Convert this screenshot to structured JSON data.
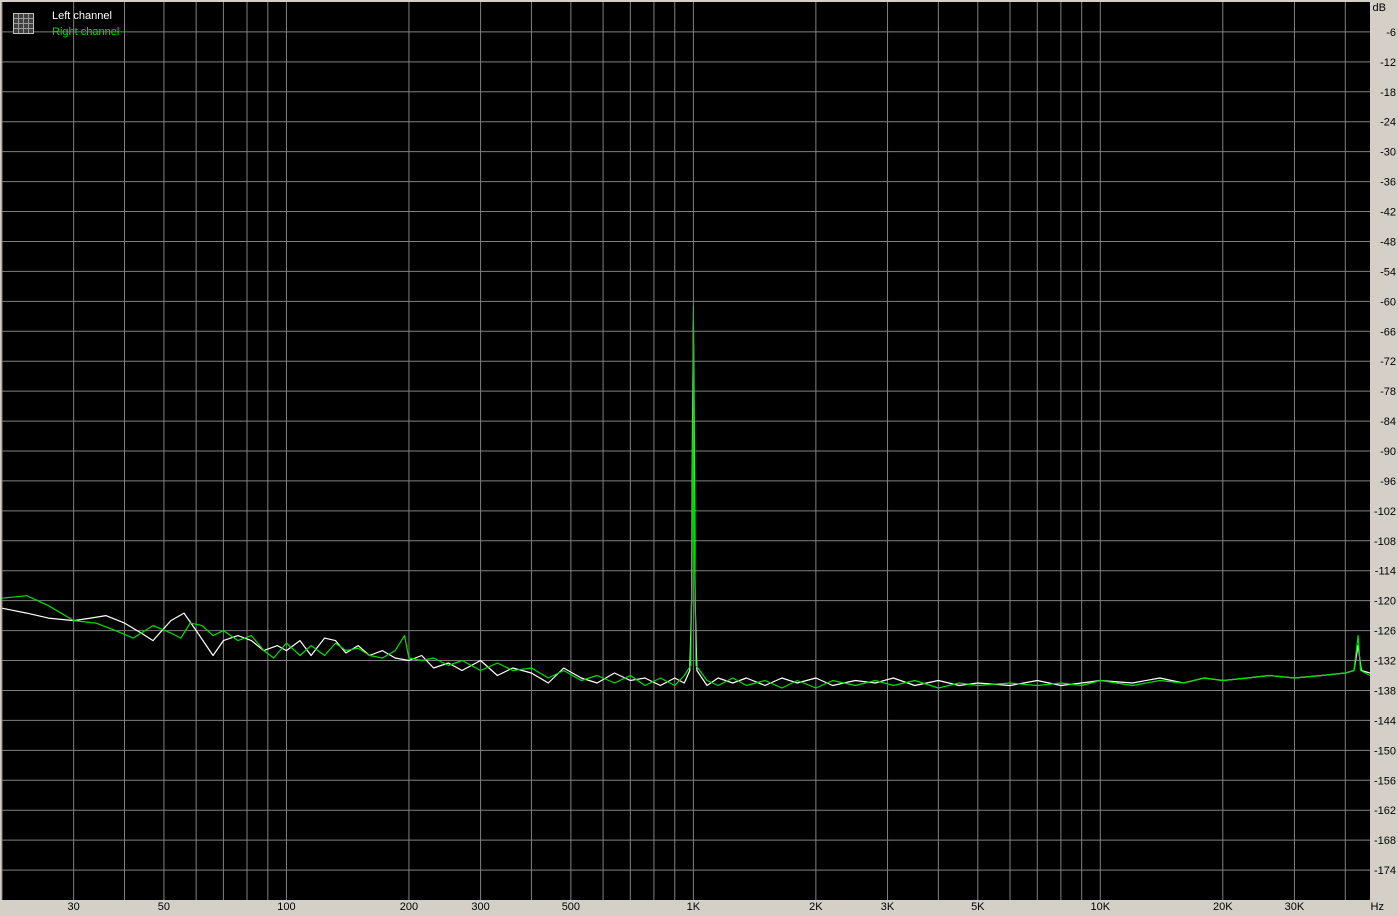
{
  "chart_data": {
    "type": "line",
    "title": "",
    "xlabel": "",
    "ylabel": "",
    "x_unit": "Hz",
    "y_unit": "dB",
    "x_scale": "log",
    "xlim": [
      20,
      46000
    ],
    "ylim": [
      -180,
      0
    ],
    "grid": true,
    "legend_position": "top-left",
    "background_color": "#000000",
    "grid_color": "#808080",
    "frame_color": "#d4d0c8",
    "legend_icon": "spectrum-grid-icon",
    "x_ticks": [
      {
        "value": 30,
        "label": "30"
      },
      {
        "value": 50,
        "label": "50"
      },
      {
        "value": 100,
        "label": "100"
      },
      {
        "value": 200,
        "label": "200"
      },
      {
        "value": 300,
        "label": "300"
      },
      {
        "value": 500,
        "label": "500"
      },
      {
        "value": 1000,
        "label": "1K"
      },
      {
        "value": 2000,
        "label": "2K"
      },
      {
        "value": 3000,
        "label": "3K"
      },
      {
        "value": 5000,
        "label": "5K"
      },
      {
        "value": 10000,
        "label": "10K"
      },
      {
        "value": 20000,
        "label": "20K"
      },
      {
        "value": 30000,
        "label": "30K"
      }
    ],
    "y_ticks": [
      -6,
      -12,
      -18,
      -24,
      -30,
      -36,
      -42,
      -48,
      -54,
      -60,
      -66,
      -72,
      -78,
      -84,
      -90,
      -96,
      -102,
      -108,
      -114,
      -120,
      -126,
      -132,
      -138,
      -144,
      -150,
      -156,
      -162,
      -168,
      -174
    ],
    "series": [
      {
        "name": "Left channel",
        "color": "#ffffff",
        "points": [
          [
            20,
            -121.5
          ],
          [
            23,
            -122.5
          ],
          [
            26,
            -123.5
          ],
          [
            30,
            -124
          ],
          [
            33,
            -123.5
          ],
          [
            36,
            -123
          ],
          [
            40,
            -124.5
          ],
          [
            44,
            -126.5
          ],
          [
            47,
            -128
          ],
          [
            52,
            -124
          ],
          [
            56,
            -122.5
          ],
          [
            60,
            -126
          ],
          [
            66,
            -131
          ],
          [
            70,
            -128
          ],
          [
            76,
            -127
          ],
          [
            82,
            -128
          ],
          [
            88,
            -130
          ],
          [
            95,
            -129
          ],
          [
            100,
            -130
          ],
          [
            108,
            -128
          ],
          [
            115,
            -131
          ],
          [
            124,
            -127.5
          ],
          [
            132,
            -128
          ],
          [
            140,
            -130.5
          ],
          [
            150,
            -129
          ],
          [
            160,
            -131
          ],
          [
            172,
            -130
          ],
          [
            185,
            -131.5
          ],
          [
            200,
            -132
          ],
          [
            215,
            -131
          ],
          [
            230,
            -133.5
          ],
          [
            250,
            -132.5
          ],
          [
            270,
            -134
          ],
          [
            300,
            -132
          ],
          [
            330,
            -135
          ],
          [
            360,
            -133.5
          ],
          [
            400,
            -134.5
          ],
          [
            440,
            -136.5
          ],
          [
            480,
            -133.5
          ],
          [
            530,
            -135.5
          ],
          [
            580,
            -136.5
          ],
          [
            640,
            -134.5
          ],
          [
            700,
            -136
          ],
          [
            760,
            -135.5
          ],
          [
            830,
            -137
          ],
          [
            900,
            -135.5
          ],
          [
            950,
            -136.5
          ],
          [
            980,
            -134
          ],
          [
            990,
            -120
          ],
          [
            995,
            -85
          ],
          [
            1000,
            -64
          ],
          [
            1005,
            -85
          ],
          [
            1010,
            -120
          ],
          [
            1020,
            -134
          ],
          [
            1080,
            -137
          ],
          [
            1150,
            -135.5
          ],
          [
            1250,
            -136.5
          ],
          [
            1350,
            -135.5
          ],
          [
            1500,
            -137
          ],
          [
            1650,
            -135.5
          ],
          [
            1800,
            -136.5
          ],
          [
            2000,
            -135.5
          ],
          [
            2200,
            -137
          ],
          [
            2500,
            -136
          ],
          [
            2800,
            -136.5
          ],
          [
            3100,
            -135.5
          ],
          [
            3500,
            -137
          ],
          [
            4000,
            -136
          ],
          [
            4500,
            -137
          ],
          [
            5000,
            -136.5
          ],
          [
            6000,
            -137
          ],
          [
            7000,
            -136
          ],
          [
            8000,
            -137
          ],
          [
            9000,
            -136.5
          ],
          [
            10000,
            -136
          ],
          [
            12000,
            -136.5
          ],
          [
            14000,
            -135.5
          ],
          [
            16000,
            -136.5
          ],
          [
            18000,
            -135.5
          ],
          [
            20000,
            -136
          ],
          [
            23000,
            -135.5
          ],
          [
            26000,
            -135
          ],
          [
            30000,
            -135.5
          ],
          [
            35000,
            -135
          ],
          [
            40000,
            -134.5
          ],
          [
            42000,
            -134
          ],
          [
            43000,
            -129
          ],
          [
            43800,
            -134
          ],
          [
            46000,
            -134.5
          ]
        ]
      },
      {
        "name": "Right channel",
        "color": "#00e000",
        "points": [
          [
            20,
            -119.5
          ],
          [
            23,
            -119
          ],
          [
            26,
            -121
          ],
          [
            30,
            -124
          ],
          [
            34,
            -124.5
          ],
          [
            38,
            -126
          ],
          [
            42,
            -127.5
          ],
          [
            47,
            -125
          ],
          [
            52,
            -126.5
          ],
          [
            55,
            -127.5
          ],
          [
            58,
            -124.5
          ],
          [
            62,
            -125
          ],
          [
            66,
            -127
          ],
          [
            70,
            -126
          ],
          [
            76,
            -128
          ],
          [
            82,
            -127
          ],
          [
            88,
            -130
          ],
          [
            93,
            -131.5
          ],
          [
            100,
            -128.5
          ],
          [
            108,
            -131
          ],
          [
            115,
            -129
          ],
          [
            124,
            -131
          ],
          [
            132,
            -128.5
          ],
          [
            140,
            -130
          ],
          [
            150,
            -129.5
          ],
          [
            160,
            -131
          ],
          [
            172,
            -131.5
          ],
          [
            185,
            -130
          ],
          [
            195,
            -127
          ],
          [
            200,
            -131.5
          ],
          [
            215,
            -132
          ],
          [
            230,
            -131.5
          ],
          [
            250,
            -133
          ],
          [
            270,
            -132
          ],
          [
            300,
            -134
          ],
          [
            330,
            -132.5
          ],
          [
            360,
            -134
          ],
          [
            400,
            -133.5
          ],
          [
            440,
            -135.5
          ],
          [
            480,
            -134
          ],
          [
            530,
            -136
          ],
          [
            580,
            -135
          ],
          [
            640,
            -136.5
          ],
          [
            700,
            -135
          ],
          [
            760,
            -137
          ],
          [
            830,
            -135.5
          ],
          [
            900,
            -137
          ],
          [
            950,
            -135
          ],
          [
            985,
            -133
          ],
          [
            993,
            -110
          ],
          [
            998,
            -78
          ],
          [
            1000,
            -61
          ],
          [
            1002,
            -78
          ],
          [
            1007,
            -110
          ],
          [
            1015,
            -133
          ],
          [
            1080,
            -136
          ],
          [
            1150,
            -137
          ],
          [
            1250,
            -135.5
          ],
          [
            1350,
            -137
          ],
          [
            1500,
            -136
          ],
          [
            1650,
            -137.5
          ],
          [
            1800,
            -136
          ],
          [
            2000,
            -137.5
          ],
          [
            2200,
            -136
          ],
          [
            2500,
            -137
          ],
          [
            2800,
            -136
          ],
          [
            3100,
            -137
          ],
          [
            3500,
            -136
          ],
          [
            4000,
            -137.5
          ],
          [
            4500,
            -136.5
          ],
          [
            5000,
            -137
          ],
          [
            6000,
            -136.5
          ],
          [
            7000,
            -137
          ],
          [
            8000,
            -136.5
          ],
          [
            9000,
            -137
          ],
          [
            10000,
            -136
          ],
          [
            12000,
            -137
          ],
          [
            14000,
            -136
          ],
          [
            16000,
            -136.5
          ],
          [
            18000,
            -135.5
          ],
          [
            20000,
            -136
          ],
          [
            23000,
            -135.5
          ],
          [
            26000,
            -135
          ],
          [
            30000,
            -135.5
          ],
          [
            35000,
            -135
          ],
          [
            40000,
            -134.5
          ],
          [
            42000,
            -134
          ],
          [
            43000,
            -127
          ],
          [
            43600,
            -134
          ],
          [
            46000,
            -135
          ]
        ]
      }
    ]
  }
}
